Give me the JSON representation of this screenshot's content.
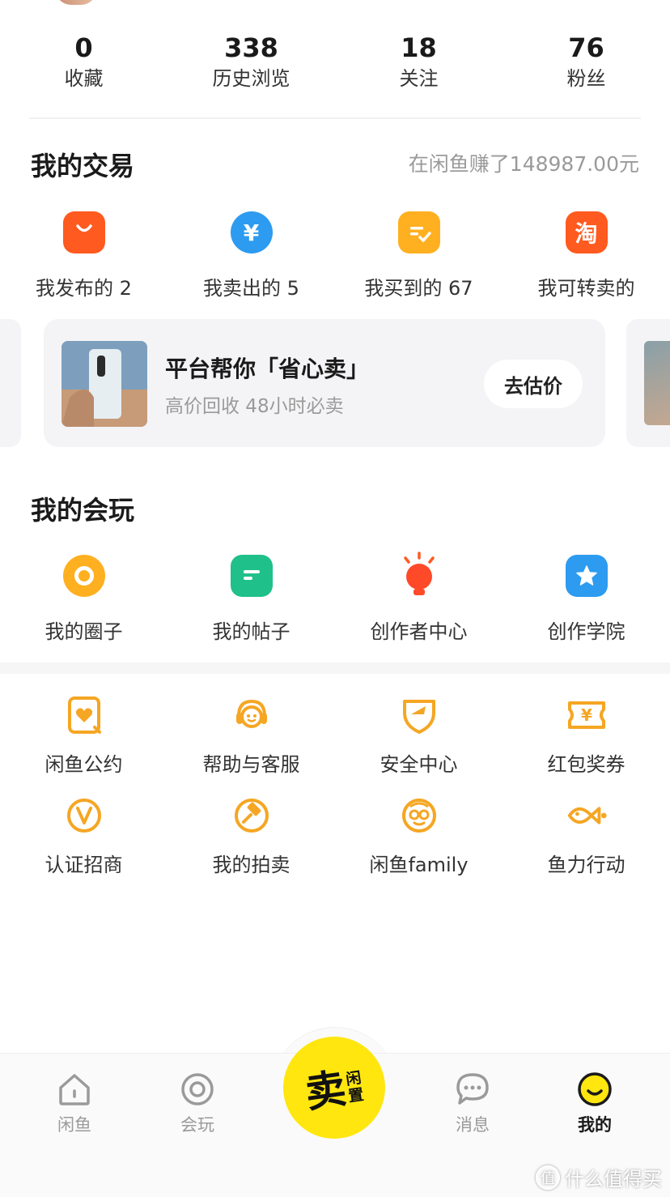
{
  "stats": [
    {
      "value": "0",
      "label": "收藏"
    },
    {
      "value": "338",
      "label": "历史浏览"
    },
    {
      "value": "18",
      "label": "关注"
    },
    {
      "value": "76",
      "label": "粉丝"
    }
  ],
  "trade": {
    "title": "我的交易",
    "earned": "在闲鱼赚了148987.00元",
    "items": [
      {
        "label": "我发布的 2",
        "icon": "shopping-bag-icon"
      },
      {
        "label": "我卖出的 5",
        "icon": "yen-coin-icon"
      },
      {
        "label": "我买到的 67",
        "icon": "order-check-icon"
      },
      {
        "label": "我可转卖的",
        "icon": "taobao-icon"
      }
    ]
  },
  "promo": {
    "title": "平台帮你「省心卖」",
    "subtitle": "高价回收 48小时必卖",
    "button": "去估价"
  },
  "play": {
    "title": "我的会玩",
    "items": [
      {
        "label": "我的圈子",
        "icon": "circle-icon"
      },
      {
        "label": "我的帖子",
        "icon": "post-icon"
      },
      {
        "label": "创作者中心",
        "icon": "lightbulb-icon"
      },
      {
        "label": "创作学院",
        "icon": "star-icon"
      }
    ]
  },
  "tools": [
    {
      "label": "闲鱼公约",
      "icon": "heart-card-icon"
    },
    {
      "label": "帮助与客服",
      "icon": "headset-icon"
    },
    {
      "label": "安全中心",
      "icon": "shield-icon"
    },
    {
      "label": "红包奖券",
      "icon": "coupon-icon"
    },
    {
      "label": "认证招商",
      "icon": "verified-v-icon"
    },
    {
      "label": "我的拍卖",
      "icon": "gavel-icon"
    },
    {
      "label": "闲鱼family",
      "icon": "family-face-icon"
    },
    {
      "label": "鱼力行动",
      "icon": "fish-icon"
    }
  ],
  "tabbar": {
    "home": "闲鱼",
    "play": "会玩",
    "sell_main": "卖",
    "sell_side": [
      "闲",
      "置"
    ],
    "messages": "消息",
    "mine": "我的"
  },
  "watermark": {
    "icon_char": "值",
    "text": "什么值得买"
  },
  "colors": {
    "accent": "#f5a623",
    "brand_yellow": "#ffe60f"
  }
}
